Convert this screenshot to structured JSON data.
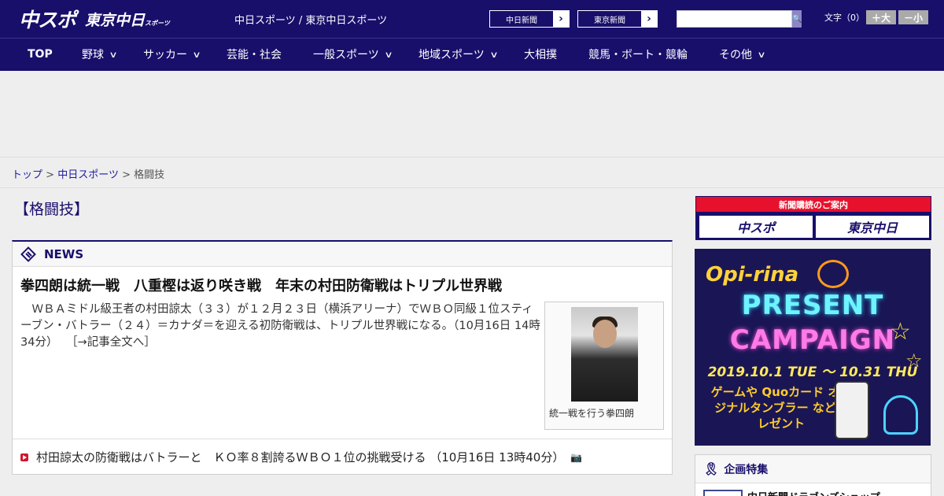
{
  "header": {
    "logo_main": "中スポ",
    "logo_tokyo": "東京中日",
    "logo_tokyo_small": "スポーツ",
    "site_links": "中日スポーツ / 東京中日スポーツ",
    "paper_buttons": [
      {
        "label": "中日新聞",
        "arrow": "›"
      },
      {
        "label": "東京新聞",
        "arrow": "›"
      }
    ],
    "search_placeholder": "",
    "search_icon": "🔍",
    "font_size_label": "文字（0）",
    "font_larger": "＋大",
    "font_smaller": "－小"
  },
  "nav": {
    "items": [
      {
        "label": "TOP",
        "dropdown": false
      },
      {
        "label": "野球",
        "dropdown": true
      },
      {
        "label": "サッカー",
        "dropdown": true
      },
      {
        "label": "芸能・社会",
        "dropdown": false
      },
      {
        "label": "一般スポーツ",
        "dropdown": true
      },
      {
        "label": "地域スポーツ",
        "dropdown": true
      },
      {
        "label": "大相撲",
        "dropdown": false
      },
      {
        "label": "競馬・ボート・競輪",
        "dropdown": false
      },
      {
        "label": "その他",
        "dropdown": true
      }
    ],
    "chevron": "∨"
  },
  "breadcrumb": {
    "items": [
      "トップ",
      "中日スポーツ",
      "格闘技"
    ],
    "separator": ">"
  },
  "page": {
    "category_title": "【格闘技】"
  },
  "news": {
    "section_title": "NEWS",
    "headline": "拳四朗は統一戦　八重樫は返り咲き戦　年末の村田防衛戦はトリプル世界戦",
    "lede": "　ＷＢＡミドル級王者の村田諒太（３３）が１２月２３日（横浜アリーナ）でＷＢＯ同級１位スティーブン・バトラー（２４）＝カナダ＝を迎える初防衛戦は、トリプル世界戦になる。（10月16日 14時34分）",
    "read_more": "［→記事全文へ］",
    "photo_caption": "統一戦を行う拳四朗",
    "sub_item": "村田諒太の防衛戦はバトラーと　ＫＯ率８割誇るＷＢＯ１位の挑戦受ける （10月16日 13時40分）",
    "sub_item_icon": "📷"
  },
  "sidebar": {
    "subscribe_title": "新聞購読のご案内",
    "subscribe_buttons": [
      "中スポ",
      "東京中日"
    ],
    "promo": {
      "brand": "Opi-rina",
      "line1": "PRESENT",
      "line2": "CAMPAIGN",
      "dates": "2019.10.1 TUE 〜 10.31 THU",
      "desc": "ゲームや Quoカード オリジナルタンブラー などプレゼント"
    },
    "feature_title": "企画特集",
    "feature_item": "中日新聞ドラゴンズショップ"
  }
}
